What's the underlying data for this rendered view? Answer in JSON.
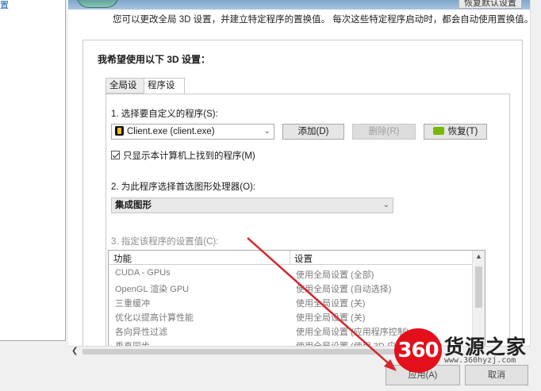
{
  "left_panel": {
    "link_text": "置"
  },
  "header": {
    "restore_defaults": "恢复默认设置"
  },
  "intro_text": "您可以更改全局 3D 设置，并建立特定程序的置换值。 每次这些特定程序启动时，都会自动使用置换值。",
  "settings": {
    "title": "我希望使用以下 3D 设置：",
    "tabs": [
      {
        "label": "全局设置"
      },
      {
        "label": "程序设置"
      }
    ],
    "step1_label": "1. 选择要自定义的程序(S):",
    "program_select_value": "Client.exe (client.exe)",
    "add_button": "添加(D)",
    "delete_button": "删除(R)",
    "restore_button": "恢复(T)",
    "show_only_checkbox": "只显示本计算机上找到的程序(M)",
    "step2_label": "2. 为此程序选择首选图形处理器(O):",
    "gpu_select_value": "集成图形",
    "step3_label": "3. 指定该程序的设置值(C):",
    "table": {
      "headers": [
        "功能",
        "设置"
      ],
      "rows": [
        {
          "feature": "CUDA - GPUs",
          "setting": "使用全局设置 (全部)"
        },
        {
          "feature": "OpenGL 渲染 GPU",
          "setting": "使用全局设置 (自动选择)"
        },
        {
          "feature": "三重缓冲",
          "setting": "使用全局设置 (关)"
        },
        {
          "feature": "优化以提高计算性能",
          "setting": "使用全局设置 (关)"
        },
        {
          "feature": "各向异性过滤",
          "setting": "使用全局设置 (应用程序控制)"
        },
        {
          "feature": "垂直同步",
          "setting": "使用全局设置 (使用 3D 应用程序设置)"
        }
      ]
    }
  },
  "bottom_buttons": {
    "apply": "应用(A)",
    "cancel": "取消"
  },
  "watermark": {
    "badge": "360",
    "brand": "货源之家",
    "url": "www.360hyzj.com"
  },
  "colors": {
    "link": "#1a5fb4",
    "nvidia_green": "#76b900",
    "watermark_red": "#e3101c",
    "arrow_red": "#d8232a"
  }
}
